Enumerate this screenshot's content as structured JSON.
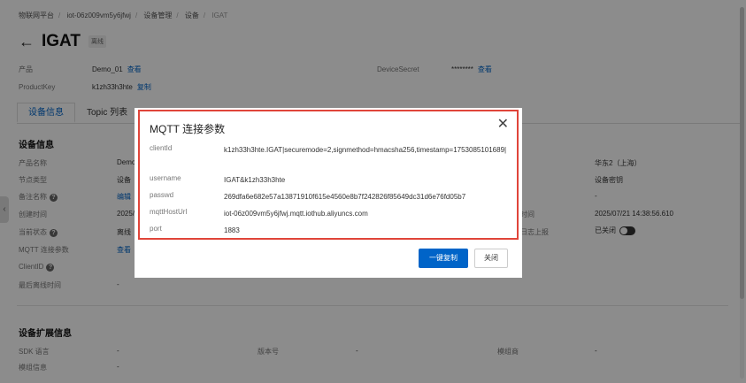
{
  "breadcrumb": [
    "物联网平台",
    "iot-06z009vm5y6jfwj",
    "设备管理",
    "设备",
    "IGAT"
  ],
  "page": {
    "title": "IGAT",
    "status_tag": "离线"
  },
  "product_info": {
    "product_label": "产品",
    "product_value": "Demo_01",
    "product_link": "查看",
    "productkey_label": "ProductKey",
    "productkey_value": "k1zh33h3hte",
    "productkey_link": "复制",
    "devicesecret_label": "DeviceSecret",
    "devicesecret_value": "********",
    "devicesecret_link": "查看"
  },
  "tabs": [
    "设备信息",
    "Topic 列表"
  ],
  "device_info": {
    "section_title": "设备信息",
    "rows": [
      {
        "label": "产品名称",
        "value": "Demo"
      },
      {
        "label": "节点类型",
        "value": "设备"
      },
      {
        "label": "备注名称",
        "value": "编辑"
      },
      {
        "label": "创建时间",
        "value": "2025/"
      },
      {
        "label": "当前状态",
        "value": "离线"
      },
      {
        "label": "MQTT 连接参数",
        "value": "查看"
      },
      {
        "label": "ClientID",
        "value": ""
      },
      {
        "label": "最后离线时间",
        "value": "-"
      }
    ],
    "right_rows": [
      {
        "label": "",
        "value": "华东2（上海）"
      },
      {
        "label": "",
        "value": "设备密钥"
      },
      {
        "label": "",
        "value": "-"
      },
      {
        "label": "时间",
        "value": "2025/07/21 14:38:56.610"
      },
      {
        "label": "日志上报",
        "value": "已关闭"
      }
    ]
  },
  "ext_info": {
    "section_title": "设备扩展信息",
    "sdk_label": "SDK 语言",
    "sdk_value": "-",
    "version_label": "版本号",
    "version_value": "-",
    "module_label": "模组商",
    "module_value": "-",
    "modinfo_label": "模组信息",
    "modinfo_value": "-"
  },
  "modal": {
    "title": "MQTT 连接参数",
    "rows": [
      {
        "key": "clientId",
        "value": "k1zh33h3hte.IGAT|securemode=2,signmethod=hmacsha256,timestamp=1753085101689|"
      },
      {
        "key": "username",
        "value": "IGAT&k1zh33h3hte"
      },
      {
        "key": "passwd",
        "value": "269dfa6e682e57a13871910f615e4560e8b7f242826f85649dc31d6e76fd05b7"
      },
      {
        "key": "mqttHostUrl",
        "value": "iot-06z009vm5y6jfwj.mqtt.iothub.aliyuncs.com"
      },
      {
        "key": "port",
        "value": "1883"
      }
    ],
    "copy_button": "一键复制",
    "close_button": "关闭"
  },
  "colors": {
    "accent": "#0064c8",
    "highlight": "#e0453a"
  }
}
